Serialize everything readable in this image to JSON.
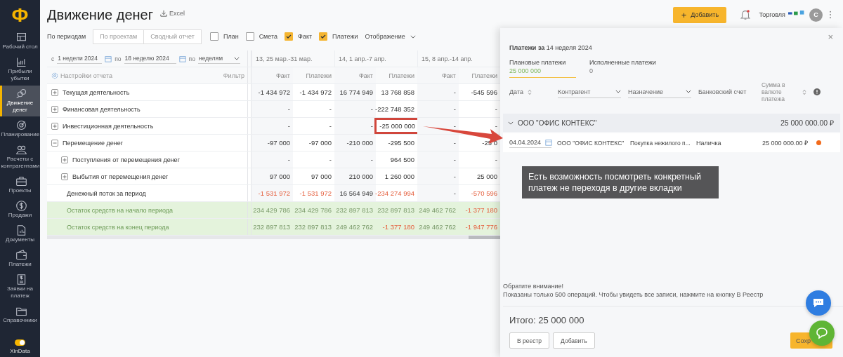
{
  "sidebar": {
    "logo": "Ф",
    "items": [
      {
        "label": "Рабочий стол",
        "selected": false
      },
      {
        "label": "Прибыли убытки",
        "selected": false
      },
      {
        "label": "Движение денег",
        "selected": true
      },
      {
        "label": "Планирование",
        "selected": false
      },
      {
        "label": "Расчеты с контрагентами",
        "selected": false
      },
      {
        "label": "Проекты",
        "selected": false
      },
      {
        "label": "Продажи",
        "selected": false
      },
      {
        "label": "Документы",
        "selected": false
      },
      {
        "label": "Платежи",
        "selected": false
      },
      {
        "label": "Заявки на платеж",
        "selected": false
      },
      {
        "label": "Справочники",
        "selected": false
      }
    ],
    "toggle": {
      "on": true
    },
    "brand": "XinData"
  },
  "header": {
    "title": "Движение денег",
    "export": "Excel",
    "add_button": "Добавить",
    "add_icon": "+",
    "company": "Торговля",
    "avatar": "С"
  },
  "toolbar": {
    "label": "По периодам",
    "views": [
      {
        "label": "По проектам",
        "selected": false
      },
      {
        "label": "Сводный отчет",
        "selected": false
      }
    ],
    "checkboxes": [
      {
        "label": "План",
        "checked": false
      },
      {
        "label": "Смета",
        "checked": false
      },
      {
        "label": "Факт",
        "checked": true
      },
      {
        "label": "Платежи",
        "checked": true
      }
    ],
    "display": "Отображение"
  },
  "filters": {
    "from_label": "с",
    "from": "1 недели 2024",
    "to_label": "по",
    "to": "18 неделю 2024",
    "by_label": "по",
    "by": "неделям"
  },
  "report": {
    "settings": "Настройки отчета",
    "filter": "Фильтр",
    "periods": [
      {
        "label": "13, 25 мар.-31 мар.",
        "columns": [
          "Факт",
          "Платежи"
        ]
      },
      {
        "label": "14, 1 апр.-7 апр.",
        "columns": [
          "Факт",
          "Платежи"
        ]
      },
      {
        "label": "15, 8 апр.-14 апр.",
        "columns": [
          "Факт",
          "Платежи"
        ]
      }
    ],
    "rows": [
      {
        "kind": "group",
        "name": "Текущая деятельность",
        "expanded": false,
        "cells": [
          {
            "text": "-1 434 972",
            "red": false,
            "framed": false
          },
          {
            "text": "-1 434 972",
            "red": false,
            "framed": false
          },
          {
            "text": "16 774 949",
            "red": false,
            "framed": false
          },
          {
            "text": "13 768 858",
            "red": false,
            "framed": false
          },
          {
            "text": "-",
            "red": false,
            "framed": false
          },
          {
            "text": "-545 596",
            "red": false,
            "framed": false
          }
        ]
      },
      {
        "kind": "group",
        "name": "Финансовая деятельность",
        "expanded": false,
        "cells": [
          {
            "text": "-",
            "red": false,
            "framed": false
          },
          {
            "text": "-",
            "red": false,
            "framed": false
          },
          {
            "text": "-",
            "red": false,
            "framed": false
          },
          {
            "text": "-222 748 352",
            "red": false,
            "framed": false
          },
          {
            "text": "-",
            "red": false,
            "framed": false
          },
          {
            "text": "-",
            "red": false,
            "framed": false
          }
        ]
      },
      {
        "kind": "group",
        "name": "Инвестиционная деятельность",
        "expanded": false,
        "cells": [
          {
            "text": "-",
            "red": false,
            "framed": false
          },
          {
            "text": "-",
            "red": false,
            "framed": false
          },
          {
            "text": "-",
            "red": false,
            "framed": false
          },
          {
            "text": "-25 000 000",
            "red": false,
            "framed": true
          },
          {
            "text": "-",
            "red": false,
            "framed": false
          },
          {
            "text": "-",
            "red": false,
            "framed": false
          }
        ]
      },
      {
        "kind": "group",
        "name": "Перемещение денег",
        "expanded": true,
        "cells": [
          {
            "text": "-97 000",
            "red": false,
            "framed": false
          },
          {
            "text": "-97 000",
            "red": false,
            "framed": false
          },
          {
            "text": "-210 000",
            "red": false,
            "framed": false
          },
          {
            "text": "-295 500",
            "red": false,
            "framed": false
          },
          {
            "text": "-",
            "red": false,
            "framed": false
          },
          {
            "text": "-25 0",
            "red": false,
            "framed": false
          }
        ],
        "children": [
          {
            "kind": "group",
            "name": "Поступления от перемещения денег",
            "expanded": false,
            "cells": [
              {
                "text": "-",
                "red": false,
                "framed": false
              },
              {
                "text": "-",
                "red": false,
                "framed": false
              },
              {
                "text": "-",
                "red": false,
                "framed": false
              },
              {
                "text": "964 500",
                "red": false,
                "framed": false
              },
              {
                "text": "-",
                "red": false,
                "framed": false
              },
              {
                "text": "-",
                "red": false,
                "framed": false
              }
            ]
          },
          {
            "kind": "group",
            "name": "Выбытия от перемещения денег",
            "expanded": false,
            "cells": [
              {
                "text": "97 000",
                "red": false,
                "framed": false
              },
              {
                "text": "97 000",
                "red": false,
                "framed": false
              },
              {
                "text": "210 000",
                "red": false,
                "framed": false
              },
              {
                "text": "1 260 000",
                "red": false,
                "framed": false
              },
              {
                "text": "-",
                "red": false,
                "framed": false
              },
              {
                "text": "25 000",
                "red": false,
                "framed": false
              }
            ]
          }
        ]
      },
      {
        "kind": "total",
        "name": "Денежный поток за период",
        "cells": [
          {
            "text": "-1 531 972",
            "red": true,
            "framed": false
          },
          {
            "text": "-1 531 972",
            "red": true,
            "framed": false
          },
          {
            "text": "16 564 949",
            "red": false,
            "framed": false
          },
          {
            "text": "-234 274 994",
            "red": true,
            "framed": false
          },
          {
            "text": "-",
            "red": false,
            "framed": false
          },
          {
            "text": "-570 596",
            "red": true,
            "framed": false
          }
        ]
      },
      {
        "kind": "balance",
        "name": "Остаток средств на начало периода",
        "cells": [
          {
            "text": "234 429 786",
            "red": false,
            "framed": false
          },
          {
            "text": "234 429 786",
            "red": false,
            "framed": false
          },
          {
            "text": "232 897 813",
            "red": false,
            "framed": false
          },
          {
            "text": "232 897 813",
            "red": false,
            "framed": false
          },
          {
            "text": "249 462 762",
            "red": false,
            "framed": false
          },
          {
            "text": "-1 377 180",
            "red": true,
            "framed": false
          }
        ]
      },
      {
        "kind": "balance",
        "name": "Остаток средств на конец периода",
        "cells": [
          {
            "text": "232 897 813",
            "red": false,
            "framed": false
          },
          {
            "text": "232 897 813",
            "red": false,
            "framed": false
          },
          {
            "text": "249 462 762",
            "red": false,
            "framed": false
          },
          {
            "text": "-1 377 180",
            "red": true,
            "framed": false
          },
          {
            "text": "249 462 762",
            "red": false,
            "framed": false
          },
          {
            "text": "-1 947 776",
            "red": true,
            "framed": false
          }
        ]
      }
    ]
  },
  "drawer": {
    "close": "×",
    "title": "**Платежи за** 14 неделя 2024",
    "tabs": [
      {
        "label": "Плановые платежи",
        "value": "25 000 000",
        "selected": true
      },
      {
        "label": "Исполненные платежи",
        "value": "0",
        "selected": false
      }
    ],
    "columns": {
      "date": "Дата",
      "counterparty": "Контрагент",
      "purpose": "Назначение",
      "account": "Банковский счет",
      "amount": "Сумма в валюте платежа"
    },
    "group": {
      "name": "ООО \"ОФИС КОНТЕКС\"",
      "total": "25 000 000.00 ₽",
      "expanded": true
    },
    "payments": [
      {
        "date": "04.04.2024",
        "counterparty": "ООО \"ОФИС КОНТЕКС\"",
        "purpose": "Покупка нежилого п...",
        "account": "Наличка",
        "amount": "25 000 000.00 ₽",
        "color": "#f26a1b"
      }
    ],
    "notice_title": "Обратите внимание!",
    "notice": "Показаны только 500 операций. Чтобы увидеть все записи, нажмите на кнопку В Реестр",
    "total": "Итого: 25 000 000",
    "buttons": [
      "В реестр",
      "Добавить"
    ],
    "save": "Сохр"
  },
  "callout": "Есть возможность посмотреть конкретный платеж не переходя в другие вкладки"
}
